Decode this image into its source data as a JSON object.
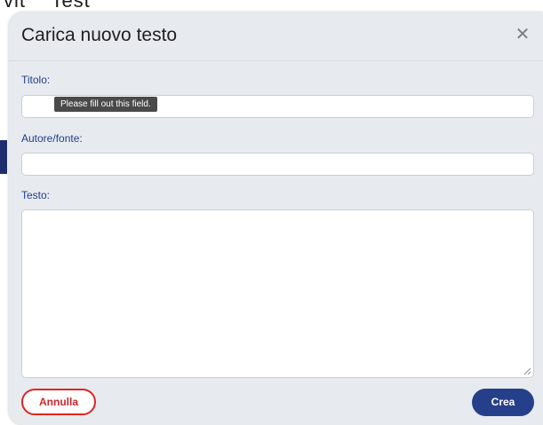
{
  "modal": {
    "title": "Carica nuovo testo",
    "close_icon": "close-icon"
  },
  "form": {
    "title_label": "Titolo:",
    "title_value": "",
    "author_label": "Autore/fonte:",
    "author_value": "",
    "text_label": "Testo:",
    "text_value": ""
  },
  "tooltip": {
    "message": "Please fill out this field."
  },
  "actions": {
    "cancel_label": "Annulla",
    "create_label": "Crea"
  },
  "colors": {
    "accent_blue": "#263f8a",
    "label_blue": "#253c88",
    "cancel_red": "#e02424",
    "modal_bg": "#e7ebef"
  }
}
